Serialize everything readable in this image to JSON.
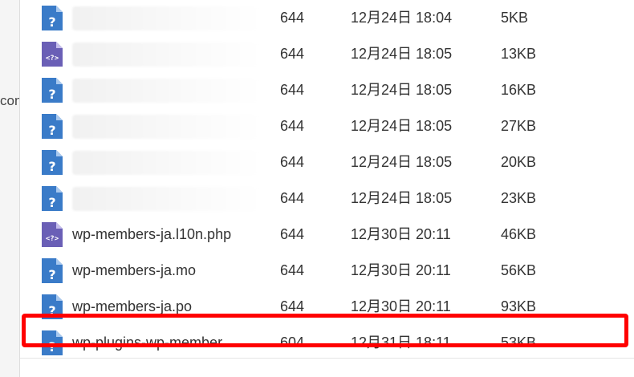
{
  "left_panel": {
    "fragment": "com"
  },
  "colors": {
    "accent": "#ff0000",
    "icon_blue": "#3a7bc8",
    "icon_purple": "#6a5fb6"
  },
  "files": [
    {
      "icon": "unknown-file-icon",
      "name": "",
      "perm": "644",
      "date": "12月24日 18:04",
      "size": "5KB",
      "blurred": true
    },
    {
      "icon": "php-file-icon",
      "name": "",
      "perm": "644",
      "date": "12月24日 18:05",
      "size": "13KB",
      "blurred": true
    },
    {
      "icon": "unknown-file-icon",
      "name": "",
      "perm": "644",
      "date": "12月24日 18:05",
      "size": "16KB",
      "blurred": true
    },
    {
      "icon": "unknown-file-icon",
      "name": "",
      "perm": "644",
      "date": "12月24日 18:05",
      "size": "27KB",
      "blurred": true
    },
    {
      "icon": "unknown-file-icon",
      "name": "",
      "perm": "644",
      "date": "12月24日 18:05",
      "size": "20KB",
      "blurred": true
    },
    {
      "icon": "unknown-file-icon",
      "name": "",
      "perm": "644",
      "date": "12月24日 18:05",
      "size": "23KB",
      "blurred": true
    },
    {
      "icon": "php-file-icon",
      "name": "wp-members-ja.l10n.php",
      "perm": "644",
      "date": "12月30日 20:11",
      "size": "46KB",
      "blurred": false
    },
    {
      "icon": "unknown-file-icon",
      "name": "wp-members-ja.mo",
      "perm": "644",
      "date": "12月30日 20:11",
      "size": "56KB",
      "blurred": false
    },
    {
      "icon": "unknown-file-icon",
      "name": "wp-members-ja.po",
      "perm": "644",
      "date": "12月30日 20:11",
      "size": "93KB",
      "blurred": false
    },
    {
      "icon": "unknown-file-icon",
      "name": "wp-plugins-wp-member…",
      "perm": "604",
      "date": "12月31日 18:11",
      "size": "53KB",
      "blurred": false,
      "highlighted": true
    }
  ]
}
